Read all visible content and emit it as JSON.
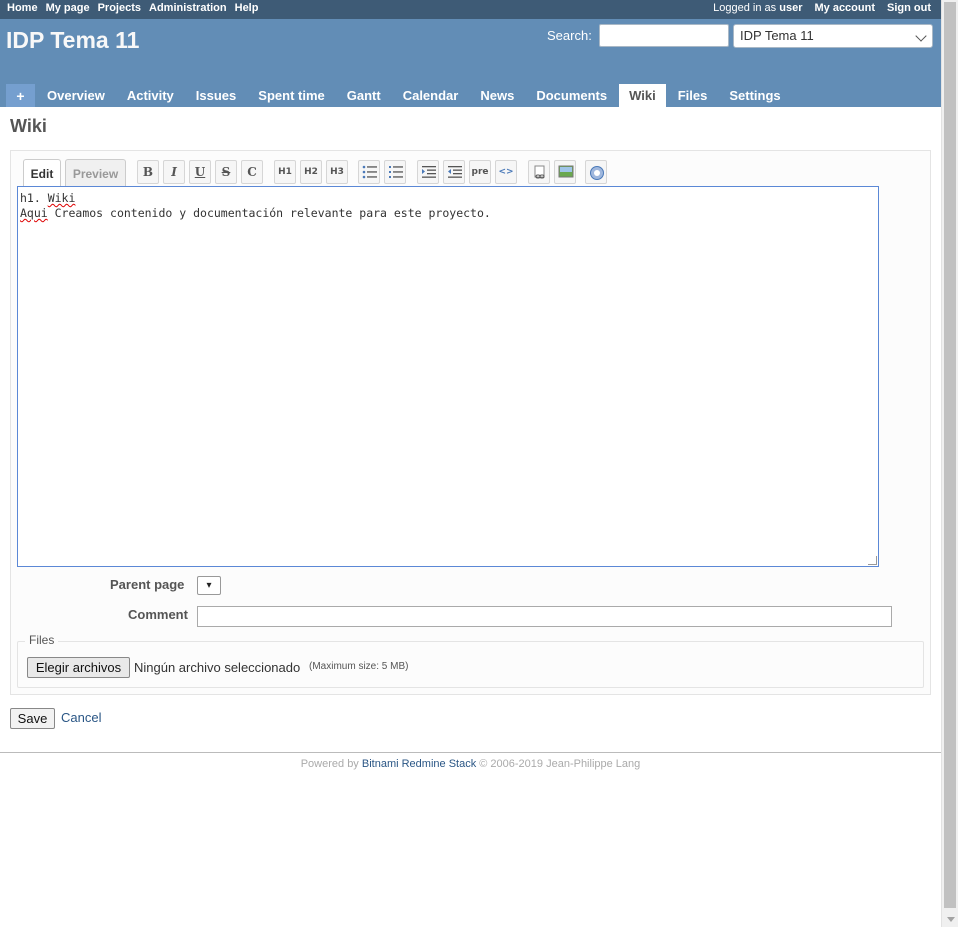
{
  "top_menu": {
    "items": [
      "Home",
      "My page",
      "Projects",
      "Administration",
      "Help"
    ],
    "logged_as_prefix": "Logged in as",
    "logged_as_user": "user",
    "my_account": "My account",
    "sign_out": "Sign out"
  },
  "header": {
    "title": "IDP Tema 11",
    "search_label": "Search:",
    "search_value": "",
    "project_select": "IDP Tema 11"
  },
  "main_menu": {
    "new": "+",
    "tabs": [
      "Overview",
      "Activity",
      "Issues",
      "Spent time",
      "Gantt",
      "Calendar",
      "News",
      "Documents",
      "Wiki",
      "Files",
      "Settings"
    ],
    "selected": "Wiki"
  },
  "page_title": "Wiki",
  "editor": {
    "tab_edit": "Edit",
    "tab_preview": "Preview",
    "toolbar": {
      "bold": "B",
      "italic": "I",
      "underline": "U",
      "strike": "S",
      "code": "C",
      "h1": "H1",
      "h2": "H2",
      "h3": "H3",
      "pre": "pre",
      "inline_code": "<>"
    },
    "line1_a": "h1. ",
    "line1_b": "Wiki",
    "line2_a": "Aqui",
    "line2_b": " Creamos contenido y documentación relevante para este proyecto."
  },
  "form": {
    "parent_page_label": "Parent page",
    "parent_page_value": "▾",
    "comment_label": "Comment",
    "comment_value": ""
  },
  "files": {
    "legend": "Files",
    "choose_button": "Elegir archivos",
    "no_file": "Ningún archivo seleccionado",
    "max_size": "(Maximum size: 5 MB)"
  },
  "actions": {
    "save": "Save",
    "cancel": "Cancel"
  },
  "footer": {
    "powered_by": "Powered by",
    "link": "Bitnami Redmine Stack",
    "copyright": "© 2006-2019 Jean-Philippe Lang"
  }
}
